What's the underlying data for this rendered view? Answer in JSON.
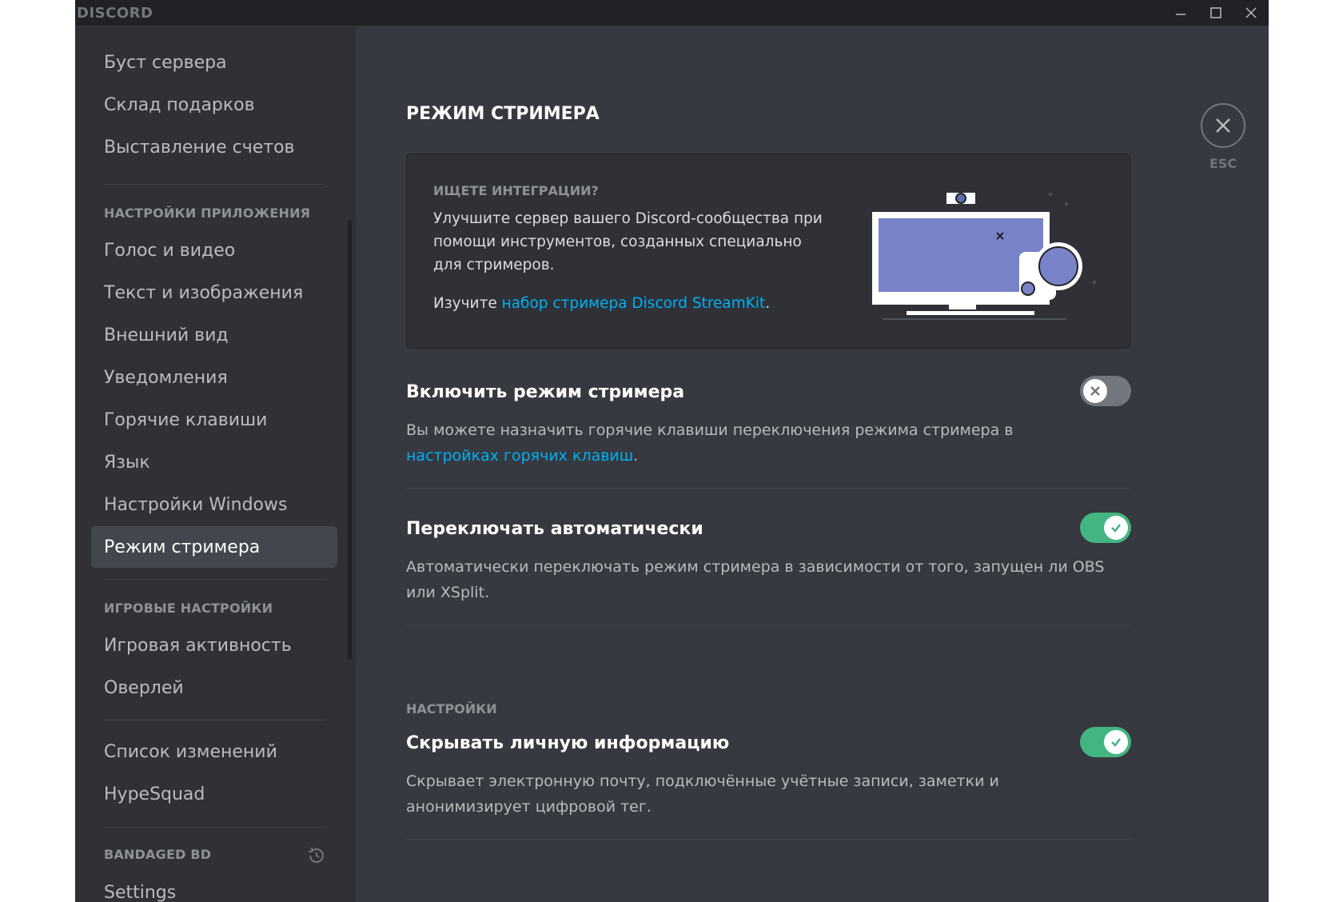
{
  "titlebar": {
    "brand": "DISCORD",
    "controls": [
      "minimize-icon",
      "maximize-icon",
      "close-icon"
    ]
  },
  "sidebar": {
    "group_top": [
      {
        "label": "Буст сервера"
      },
      {
        "label": "Склад подарков"
      },
      {
        "label": "Выставление счетов"
      }
    ],
    "app_settings_header": "НАСТРОЙКИ ПРИЛОЖЕНИЯ",
    "app_settings": [
      {
        "label": "Голос и видео"
      },
      {
        "label": "Текст и изображения"
      },
      {
        "label": "Внешний вид"
      },
      {
        "label": "Уведомления"
      },
      {
        "label": "Горячие клавиши"
      },
      {
        "label": "Язык"
      },
      {
        "label": "Настройки Windows"
      },
      {
        "label": "Режим стримера",
        "selected": true
      }
    ],
    "game_settings_header": "ИГРОВЫЕ НАСТРОЙКИ",
    "game_settings": [
      {
        "label": "Игровая активность"
      },
      {
        "label": "Оверлей"
      }
    ],
    "misc": [
      {
        "label": "Список изменений"
      },
      {
        "label": "HypeSquad"
      }
    ],
    "plugin_header": "BANDAGED BD",
    "plugin_items": [
      {
        "label": "Settings"
      }
    ]
  },
  "main": {
    "title": "РЕЖИМ СТРИМЕРА",
    "close_label": "ESC",
    "banner": {
      "eyebrow": "ИЩЕТЕ ИНТЕГРАЦИИ?",
      "text": "Улучшите сервер вашего Discord-сообщества при помощи инструментов, созданных специально для стримеров.",
      "link_prefix": "Изучите ",
      "link_text": "набор стримера Discord StreamKit",
      "link_suffix": "."
    },
    "settings": [
      {
        "title": "Включить режим стримера",
        "desc_prefix": "Вы можете назначить горячие клавиши переключения режима стримера в ",
        "desc_link": "настройках горячих клавиш",
        "desc_suffix": ".",
        "enabled": false
      },
      {
        "title": "Переключать автоматически",
        "desc": "Автоматически переключать режим стримера в зависимости от того, запущен ли OBS или XSplit.",
        "enabled": true
      }
    ],
    "options_header": "НАСТРОЙКИ",
    "options": [
      {
        "title": "Скрывать личную информацию",
        "desc": "Скрывает электронную почту, подключённые учётные записи, заметки и анонимизирует цифровой тег.",
        "enabled": true
      }
    ]
  },
  "colors": {
    "accent_link": "#00b0f4",
    "toggle_on": "#43b581",
    "toggle_off": "#72767d",
    "background": "#36393f",
    "sidebar": "#2f3136"
  }
}
